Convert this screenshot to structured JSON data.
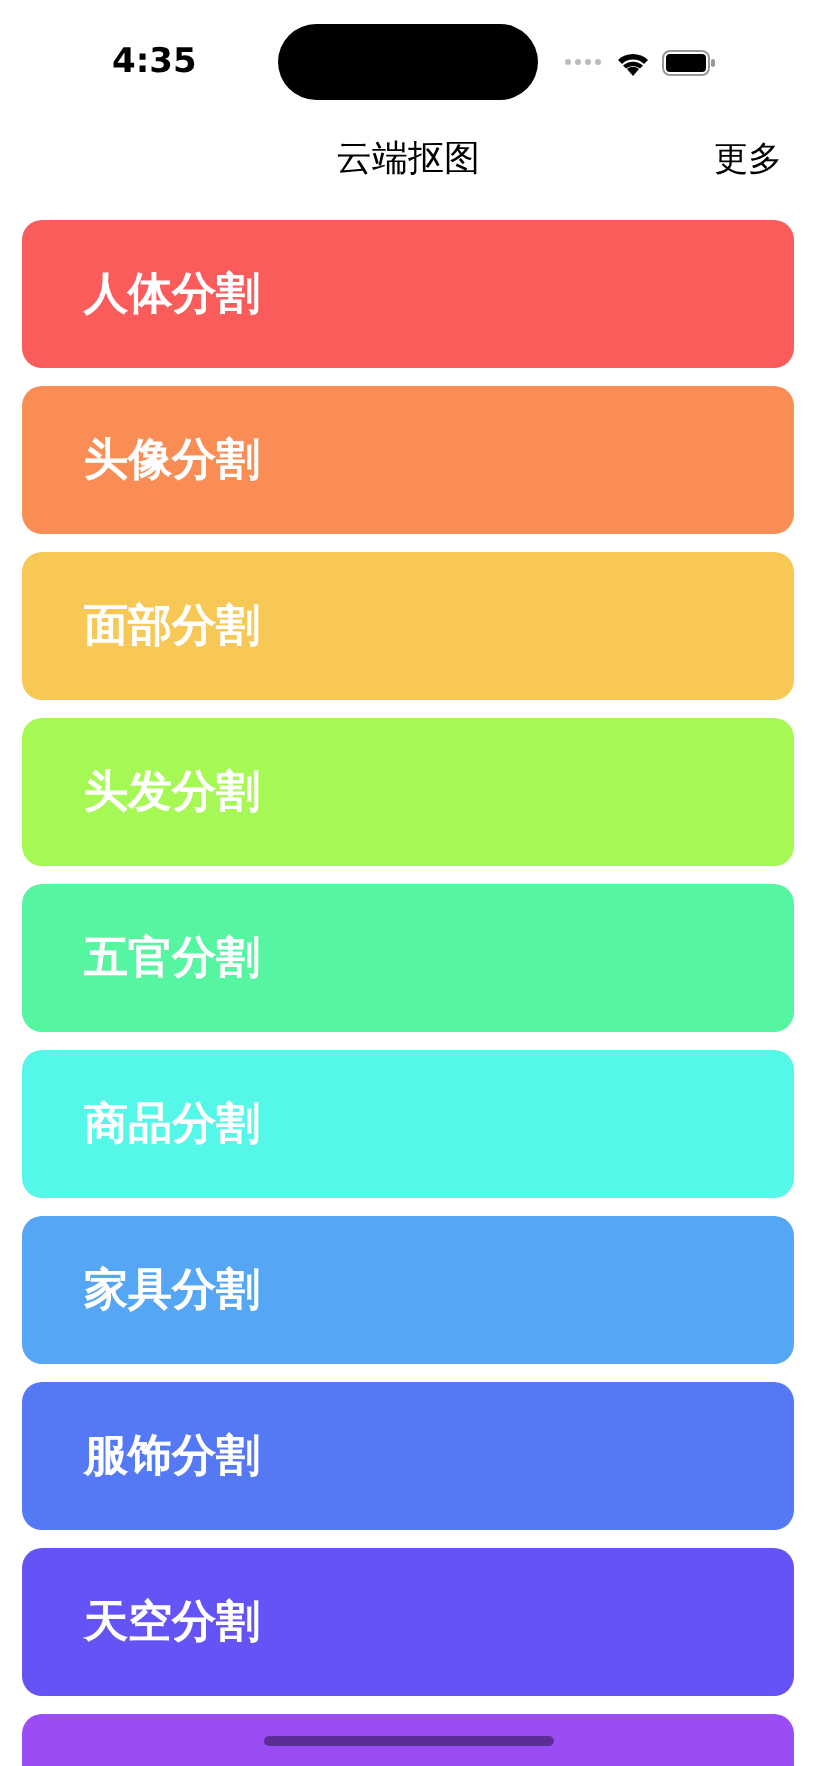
{
  "status_bar": {
    "time": "4:35"
  },
  "nav_bar": {
    "title": "云端抠图",
    "action": "更多"
  },
  "items": [
    {
      "label": "人体分割",
      "color": "#fa5c5c"
    },
    {
      "label": "头像分割",
      "color": "#f98d55"
    },
    {
      "label": "面部分割",
      "color": "#f8c856"
    },
    {
      "label": "头发分割",
      "color": "#a6f855"
    },
    {
      "label": "五官分割",
      "color": "#55f5a2"
    },
    {
      "label": "商品分割",
      "color": "#55f8e8"
    },
    {
      "label": "家具分割",
      "color": "#55a6f5"
    },
    {
      "label": "服饰分割",
      "color": "#5579f5"
    },
    {
      "label": "天空分割",
      "color": "#6453f5"
    },
    {
      "color": "#9a4cf5"
    }
  ]
}
